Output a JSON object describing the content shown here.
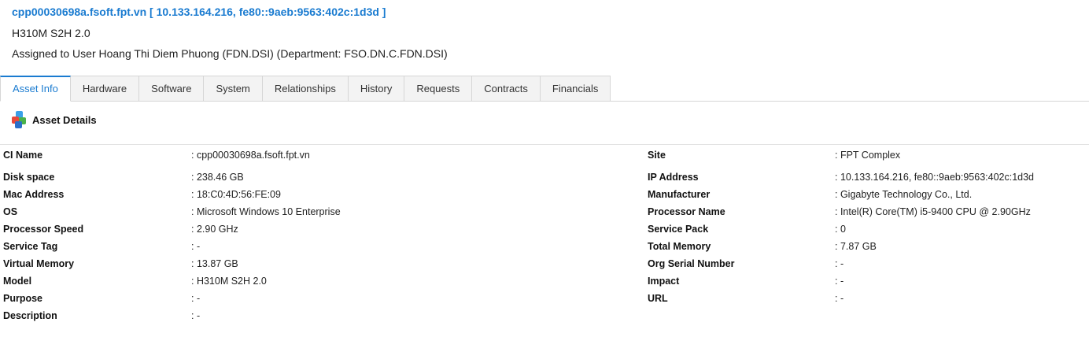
{
  "header": {
    "title": "cpp00030698a.fsoft.fpt.vn [ 10.133.164.216, fe80::9aeb:9563:402c:1d3d ]",
    "model": "H310M S2H 2.0",
    "assignment": "Assigned to User Hoang Thi Diem Phuong (FDN.DSI) (Department: FSO.DN.C.FDN.DSI)"
  },
  "tabs": [
    {
      "label": "Asset Info",
      "active": true
    },
    {
      "label": "Hardware"
    },
    {
      "label": "Software"
    },
    {
      "label": "System"
    },
    {
      "label": "Relationships"
    },
    {
      "label": "History"
    },
    {
      "label": "Requests"
    },
    {
      "label": "Contracts"
    },
    {
      "label": "Financials"
    }
  ],
  "section": {
    "title": "Asset Details",
    "icon": "cubes-icon"
  },
  "details": {
    "left": [
      {
        "label": "CI Name",
        "value": ": cpp00030698a.fsoft.fpt.vn"
      },
      {
        "label": "Disk space",
        "value": ": 238.46 GB"
      },
      {
        "label": "Mac Address",
        "value": ": 18:C0:4D:56:FE:09"
      },
      {
        "label": "OS",
        "value": ": Microsoft Windows 10 Enterprise"
      },
      {
        "label": "Processor Speed",
        "value": ": 2.90 GHz"
      },
      {
        "label": "Service Tag",
        "value": ": -"
      },
      {
        "label": "Virtual Memory",
        "value": ": 13.87 GB"
      },
      {
        "label": "Model",
        "value": ": H310M S2H 2.0"
      },
      {
        "label": "Purpose",
        "value": ": -"
      },
      {
        "label": "Description",
        "value": ": -"
      }
    ],
    "right": [
      {
        "label": "Site",
        "value": ": FPT Complex"
      },
      {
        "label": "IP Address",
        "value": ": 10.133.164.216, fe80::9aeb:9563:402c:1d3d"
      },
      {
        "label": "Manufacturer",
        "value": ": Gigabyte Technology Co., Ltd."
      },
      {
        "label": "Processor Name",
        "value": ": Intel(R) Core(TM) i5-9400 CPU @ 2.90GHz"
      },
      {
        "label": "Service Pack",
        "value": ": 0"
      },
      {
        "label": "Total Memory",
        "value": ": 7.87 GB"
      },
      {
        "label": "Org Serial Number",
        "value": ": -"
      },
      {
        "label": "Impact",
        "value": ": -"
      },
      {
        "label": "URL",
        "value": ": -"
      }
    ]
  },
  "colors": {
    "accent": "#1a7bd0",
    "tab_bg": "#f3f3f3",
    "border": "#d6d6d6"
  }
}
